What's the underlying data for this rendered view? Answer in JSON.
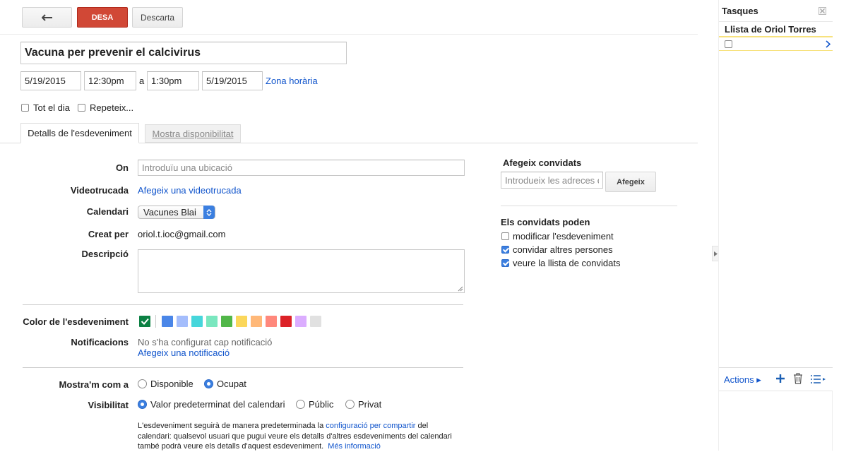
{
  "toolbar": {
    "back_icon": "arrow-left-icon",
    "save_label": "DESA",
    "discard_label": "Descarta"
  },
  "event": {
    "title": "Vacuna per prevenir el calcivirus",
    "start_date": "5/19/2015",
    "start_time": "12:30pm",
    "to_label": "a",
    "end_time": "1:30pm",
    "end_date": "5/19/2015",
    "timezone_link": "Zona horària",
    "all_day_label": "Tot el dia",
    "repeat_label": "Repeteix..."
  },
  "tabs": {
    "details": "Detalls de l'esdeveniment",
    "availability": "Mostra disponibilitat"
  },
  "form": {
    "where_label": "On",
    "where_placeholder": "Introduïu una ubicació",
    "video_label": "Videotrucada",
    "video_link": "Afegeix una videotrucada",
    "calendar_label": "Calendari",
    "calendar_value": "Vacunes Blai",
    "created_by_label": "Creat per",
    "created_by_value": "oriol.t.ioc@gmail.com",
    "description_label": "Descripció",
    "color_label": "Color de l'esdeveniment",
    "colors": [
      "#0b8043",
      "#4a86e8",
      "#a4bdfc",
      "#46d6db",
      "#7ae7bf",
      "#51b749",
      "#fbd75b",
      "#ffb878",
      "#ff887c",
      "#dc2127",
      "#dbadff",
      "#e1e1e1"
    ],
    "notifications_label": "Notificacions",
    "notifications_none": "No s'ha configurat cap notificació",
    "notifications_add": "Afegeix una notificació",
    "show_as_label": "Mostra'm com a",
    "show_as_free": "Disponible",
    "show_as_busy": "Ocupat",
    "visibility_label": "Visibilitat",
    "visibility_default": "Valor predeterminat del calendari",
    "visibility_public": "Públic",
    "visibility_private": "Privat",
    "visibility_note_1": "L'esdeveniment seguirà de manera predeterminada la",
    "visibility_note_link": "configuració per compartir",
    "visibility_note_2": "del",
    "visibility_note_3": "calendari: qualsevol usuari que pugui veure els detalls d'altres esdeveniments del calendari",
    "visibility_note_4": "també podrà veure els detalls d'aquest esdeveniment.",
    "visibility_note_more": "Més informació"
  },
  "guests": {
    "title": "Afegeix convidats",
    "input_placeholder": "Introdueix les adreces e",
    "add_button": "Afegeix",
    "perms_title": "Els convidats poden",
    "perm_modify": "modificar l'esdeveniment",
    "perm_invite": "convidar altres persones",
    "perm_see_list": "veure la llista de convidats"
  },
  "tasks": {
    "title": "Tasques",
    "list_name": "Llista de Oriol Torres",
    "actions_label": "Actions ▸"
  }
}
